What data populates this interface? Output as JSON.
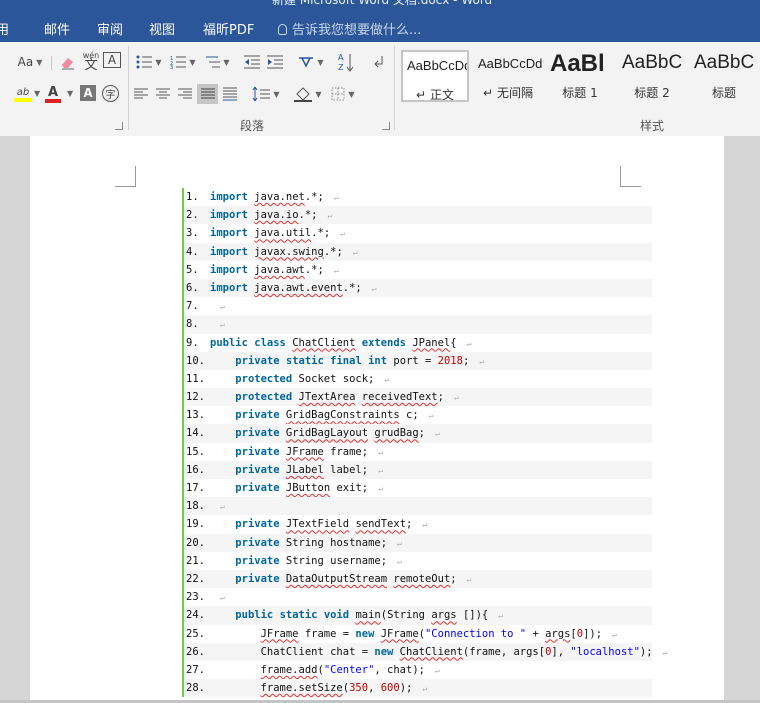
{
  "window": {
    "title": "新建 Microsoft Word 文档.docx - Word"
  },
  "tabs": [
    "用",
    "邮件",
    "审阅",
    "视图",
    "福昕PDF"
  ],
  "tell_me": {
    "placeholder": "告诉我您想要做什么..."
  },
  "ribbon": {
    "font_group": {
      "font_size_label": "Aa",
      "phonetic_label": "wén",
      "phonetic_char": "文",
      "border_char": "A",
      "enclose_char": "字",
      "highlight_label": "ab",
      "font_color_label": "A",
      "shade_label": "A"
    },
    "paragraph_group": {
      "label": "段落"
    },
    "styles_group": {
      "label": "样式",
      "items": [
        {
          "preview": "AaBbCcDd",
          "name": "正文",
          "mark": "↵"
        },
        {
          "preview": "AaBbCcDd",
          "name": "无间隔",
          "mark": "↵"
        },
        {
          "preview": "AaBl",
          "name": "标题 1"
        },
        {
          "preview": "AaBbC",
          "name": "标题 2"
        },
        {
          "preview": "AaBbC",
          "name": "标题"
        }
      ]
    }
  },
  "document": {
    "lines": [
      {
        "n": "1.",
        "parts": [
          [
            "kw",
            "import"
          ],
          [
            "t",
            " "
          ],
          [
            "sq",
            "java.net"
          ],
          [
            "t",
            ".*;"
          ]
        ]
      },
      {
        "n": "2.",
        "parts": [
          [
            "kw",
            "import"
          ],
          [
            "t",
            " "
          ],
          [
            "sq",
            "java.io"
          ],
          [
            "t",
            ".*;"
          ]
        ]
      },
      {
        "n": "3.",
        "parts": [
          [
            "kw",
            "import"
          ],
          [
            "t",
            " "
          ],
          [
            "sq",
            "java.util"
          ],
          [
            "t",
            ".*;"
          ]
        ]
      },
      {
        "n": "4.",
        "parts": [
          [
            "kw",
            "import"
          ],
          [
            "t",
            " "
          ],
          [
            "sq",
            "javax.swing"
          ],
          [
            "t",
            ".*;"
          ]
        ]
      },
      {
        "n": "5.",
        "parts": [
          [
            "kw",
            "import"
          ],
          [
            "t",
            " "
          ],
          [
            "sq",
            "java.awt"
          ],
          [
            "t",
            ".*;"
          ]
        ]
      },
      {
        "n": "6.",
        "parts": [
          [
            "kw",
            "import"
          ],
          [
            "t",
            " "
          ],
          [
            "sq",
            "java.awt.event"
          ],
          [
            "t",
            ".*;"
          ]
        ]
      },
      {
        "n": "7.",
        "parts": []
      },
      {
        "n": "8.",
        "parts": []
      },
      {
        "n": "9.",
        "parts": [
          [
            "kw",
            "public"
          ],
          [
            "t",
            " "
          ],
          [
            "kw",
            "class"
          ],
          [
            "t",
            " "
          ],
          [
            "sq",
            "ChatClient"
          ],
          [
            "t",
            " "
          ],
          [
            "kw",
            "extends"
          ],
          [
            "t",
            " "
          ],
          [
            "sq",
            "JPanel"
          ],
          [
            "t",
            "{"
          ]
        ]
      },
      {
        "n": "10.",
        "parts": [
          [
            "t",
            "    "
          ],
          [
            "kw",
            "private"
          ],
          [
            "t",
            " "
          ],
          [
            "kw",
            "static"
          ],
          [
            "t",
            " "
          ],
          [
            "kw",
            "final"
          ],
          [
            "t",
            " "
          ],
          [
            "kw",
            "int"
          ],
          [
            "t",
            " port = "
          ],
          [
            "num",
            "2018"
          ],
          [
            "t",
            ";"
          ]
        ]
      },
      {
        "n": "11.",
        "parts": [
          [
            "t",
            "    "
          ],
          [
            "kw",
            "protected"
          ],
          [
            "t",
            " Socket sock;"
          ]
        ]
      },
      {
        "n": "12.",
        "parts": [
          [
            "t",
            "    "
          ],
          [
            "kw",
            "protected"
          ],
          [
            "t",
            " "
          ],
          [
            "sq",
            "JTextArea"
          ],
          [
            "t",
            " "
          ],
          [
            "sq",
            "receivedText"
          ],
          [
            "t",
            ";"
          ]
        ]
      },
      {
        "n": "13.",
        "parts": [
          [
            "t",
            "    "
          ],
          [
            "kw",
            "private"
          ],
          [
            "t",
            " "
          ],
          [
            "sq",
            "GridBagConstraints"
          ],
          [
            "t",
            " c;"
          ]
        ]
      },
      {
        "n": "14.",
        "parts": [
          [
            "t",
            "    "
          ],
          [
            "kw",
            "private"
          ],
          [
            "t",
            " "
          ],
          [
            "sq",
            "GridBagLayout"
          ],
          [
            "t",
            " "
          ],
          [
            "sq",
            "grudBag"
          ],
          [
            "t",
            ";"
          ]
        ]
      },
      {
        "n": "15.",
        "parts": [
          [
            "t",
            "    "
          ],
          [
            "kw",
            "private"
          ],
          [
            "t",
            " "
          ],
          [
            "sq",
            "JFrame"
          ],
          [
            "t",
            " frame;"
          ]
        ]
      },
      {
        "n": "16.",
        "parts": [
          [
            "t",
            "    "
          ],
          [
            "kw",
            "private"
          ],
          [
            "t",
            " "
          ],
          [
            "sq",
            "JLabel"
          ],
          [
            "t",
            " label;"
          ]
        ]
      },
      {
        "n": "17.",
        "parts": [
          [
            "t",
            "    "
          ],
          [
            "kw",
            "private"
          ],
          [
            "t",
            " "
          ],
          [
            "sq",
            "JButton"
          ],
          [
            "t",
            " exit;"
          ]
        ]
      },
      {
        "n": "18.",
        "parts": []
      },
      {
        "n": "19.",
        "parts": [
          [
            "t",
            "    "
          ],
          [
            "kw",
            "private"
          ],
          [
            "t",
            " "
          ],
          [
            "sq",
            "JTextField"
          ],
          [
            "t",
            " "
          ],
          [
            "sq",
            "sendText"
          ],
          [
            "t",
            ";"
          ]
        ]
      },
      {
        "n": "20.",
        "parts": [
          [
            "t",
            "    "
          ],
          [
            "kw",
            "private"
          ],
          [
            "t",
            " String hostname;"
          ]
        ]
      },
      {
        "n": "21.",
        "parts": [
          [
            "t",
            "    "
          ],
          [
            "kw",
            "private"
          ],
          [
            "t",
            " String username;"
          ]
        ]
      },
      {
        "n": "22.",
        "parts": [
          [
            "t",
            "    "
          ],
          [
            "kw",
            "private"
          ],
          [
            "t",
            " "
          ],
          [
            "sq",
            "DataOutputStream"
          ],
          [
            "t",
            " "
          ],
          [
            "sq",
            "remoteOut"
          ],
          [
            "t",
            ";"
          ]
        ]
      },
      {
        "n": "23.",
        "parts": []
      },
      {
        "n": "24.",
        "parts": [
          [
            "t",
            "    "
          ],
          [
            "kw",
            "public"
          ],
          [
            "t",
            " "
          ],
          [
            "kw",
            "static"
          ],
          [
            "t",
            " "
          ],
          [
            "kw",
            "void"
          ],
          [
            "t",
            " "
          ],
          [
            "sq",
            "main"
          ],
          [
            "t",
            "(String "
          ],
          [
            "sq",
            "args"
          ],
          [
            "t",
            " []){"
          ]
        ]
      },
      {
        "n": "25.",
        "parts": [
          [
            "t",
            "        "
          ],
          [
            "sq",
            "JFrame"
          ],
          [
            "t",
            " frame = "
          ],
          [
            "kw",
            "new"
          ],
          [
            "t",
            " "
          ],
          [
            "sq",
            "JFrame"
          ],
          [
            "t",
            "("
          ],
          [
            "str",
            "\"Connection to \""
          ],
          [
            "t",
            " + "
          ],
          [
            "sq",
            "args"
          ],
          [
            "t",
            "["
          ],
          [
            "num",
            "0"
          ],
          [
            "t",
            "]);"
          ]
        ]
      },
      {
        "n": "26.",
        "parts": [
          [
            "t",
            "        ChatClient chat = "
          ],
          [
            "kw",
            "new"
          ],
          [
            "t",
            " "
          ],
          [
            "sq",
            "ChatClient"
          ],
          [
            "t",
            "(frame, args["
          ],
          [
            "num",
            "0"
          ],
          [
            "t",
            "], "
          ],
          [
            "str",
            "\"localhost\""
          ],
          [
            "t",
            ");"
          ]
        ]
      },
      {
        "n": "27.",
        "parts": [
          [
            "t",
            "        "
          ],
          [
            "sq",
            "frame.add"
          ],
          [
            "t",
            "("
          ],
          [
            "str",
            "\"Center\""
          ],
          [
            "t",
            ", chat);"
          ]
        ]
      },
      {
        "n": "28.",
        "parts": [
          [
            "t",
            "        "
          ],
          [
            "sq",
            "frame.setSize"
          ],
          [
            "t",
            "("
          ],
          [
            "num",
            "350"
          ],
          [
            "t",
            ", "
          ],
          [
            "num",
            "600"
          ],
          [
            "t",
            ");"
          ]
        ]
      }
    ]
  }
}
